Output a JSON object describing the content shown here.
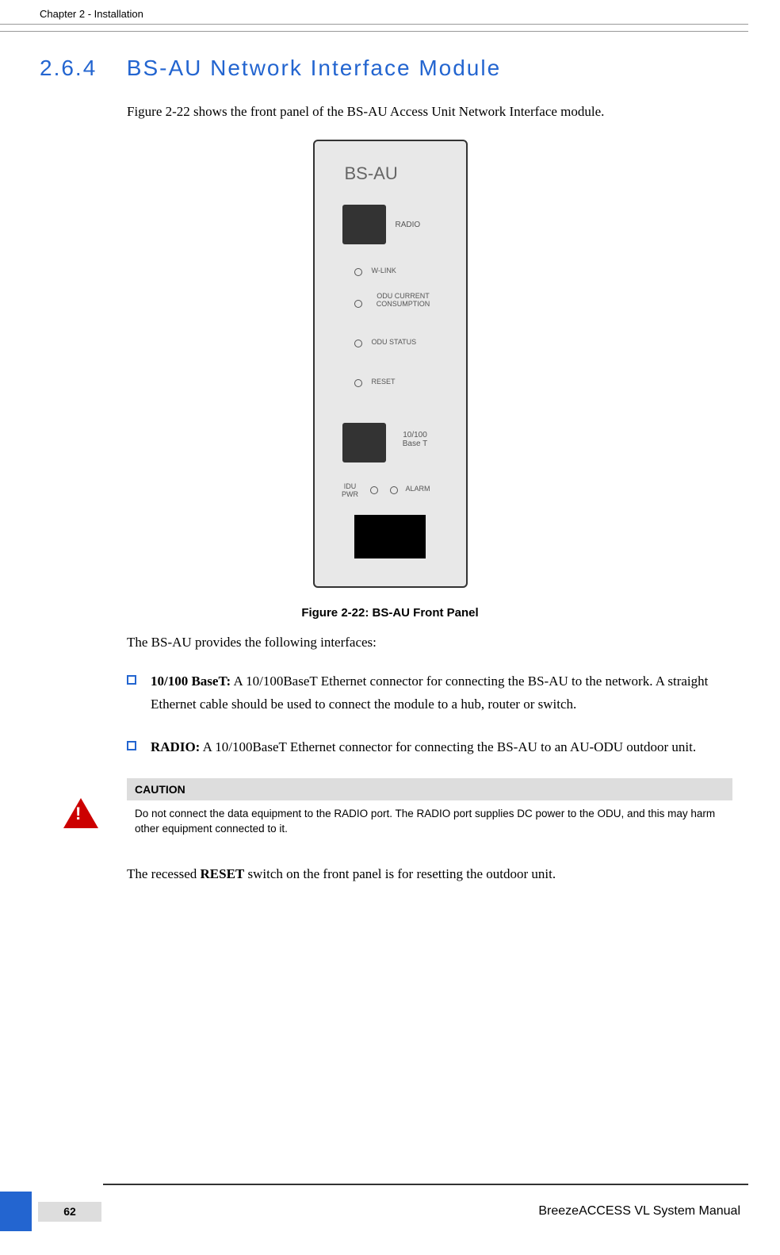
{
  "header": {
    "chapter": "Chapter 2 - Installation"
  },
  "section": {
    "number": "2.6.4",
    "title": "BS-AU Network Interface Module"
  },
  "intro": "Figure 2-22 shows the front panel of the BS-AU Access Unit Network Interface module.",
  "figure": {
    "caption": "Figure 2-22: BS-AU Front Panel",
    "module_label": "BS-AU",
    "labels": {
      "radio": "RADIO",
      "wlink": "W-LINK",
      "odu_current": "ODU CURRENT CONSUMPTION",
      "odu_status": "ODU STATUS",
      "reset": "RESET",
      "baset": "10/100 Base T",
      "idu_pwr": "IDU PWR",
      "alarm": "ALARM"
    }
  },
  "interfaces_intro": "The BS-AU provides the following interfaces:",
  "bullets": [
    {
      "bold": " 10/100 BaseT:",
      "text": " A 10/100BaseT Ethernet connector for connecting the BS-AU to the network. A straight Ethernet cable should be used to connect the module to a hub, router or switch."
    },
    {
      "bold": "RADIO:",
      "text": " A 10/100BaseT Ethernet connector for connecting the BS-AU to an AU-ODU outdoor unit."
    }
  ],
  "caution": {
    "header": "CAUTION",
    "text": "Do not connect the data equipment to the RADIO port. The RADIO port supplies DC power to the ODU, and this may harm other equipment connected to it."
  },
  "reset_text_pre": "The recessed ",
  "reset_text_bold": "RESET",
  "reset_text_post": " switch on the front panel is for resetting the outdoor unit.",
  "footer": {
    "page": "62",
    "manual": "BreezeACCESS VL System Manual"
  }
}
